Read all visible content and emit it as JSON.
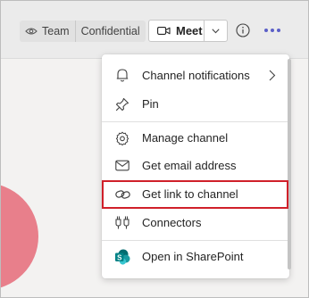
{
  "topbar": {
    "team_label": "Team",
    "confidential_label": "Confidential",
    "meet_label": "Meet"
  },
  "menu": {
    "items": [
      {
        "label": "Channel notifications",
        "icon": "bell-icon"
      },
      {
        "label": "Pin",
        "icon": "pin-icon"
      },
      {
        "label": "Manage channel",
        "icon": "gear-icon"
      },
      {
        "label": "Get email address",
        "icon": "mail-icon"
      },
      {
        "label": "Get link to channel",
        "icon": "link-icon"
      },
      {
        "label": "Connectors",
        "icon": "connectors-icon"
      },
      {
        "label": "Open in SharePoint",
        "icon": "sharepoint-icon"
      }
    ]
  },
  "colors": {
    "accent": "#5b5fc7",
    "highlight_border": "#d0202a",
    "sharepoint": "#038387"
  }
}
